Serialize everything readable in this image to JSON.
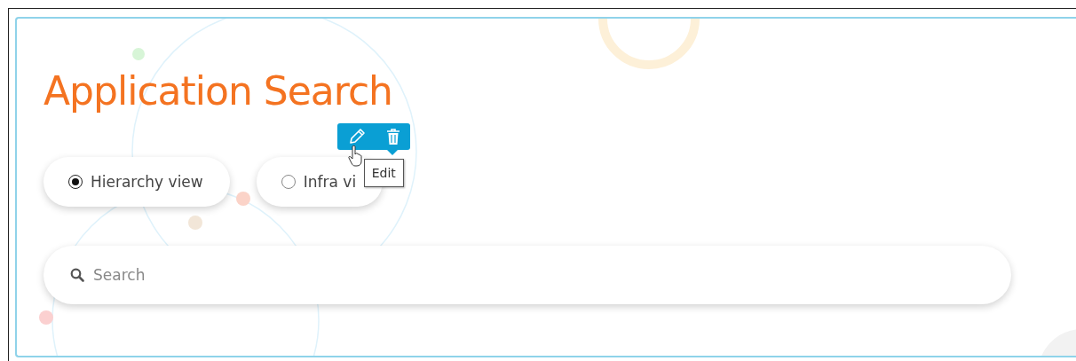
{
  "title": "Application Search",
  "view_options": [
    {
      "label": "Hierarchy view",
      "selected": true
    },
    {
      "label": "Infra vi",
      "selected": false
    }
  ],
  "toolbar": {
    "tooltip": "Edit"
  },
  "search": {
    "placeholder": "Search"
  }
}
